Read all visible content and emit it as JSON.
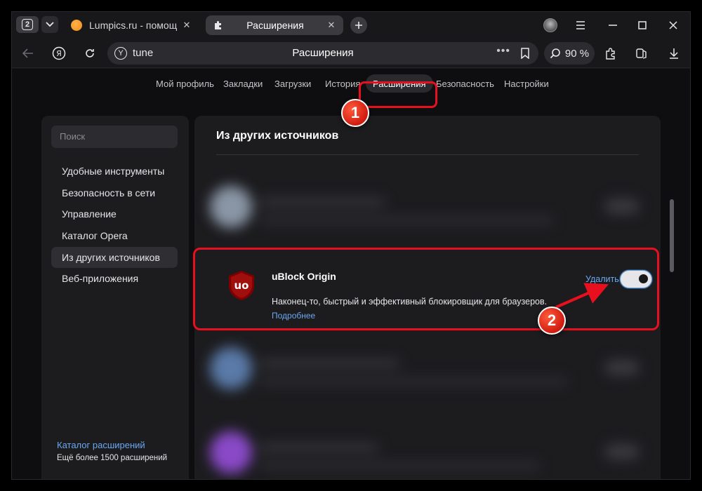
{
  "tabs": {
    "counter": "2",
    "items": [
      {
        "title": "Lumpics.ru - помощь с ком",
        "active": false
      },
      {
        "title": "Расширения",
        "active": true
      }
    ]
  },
  "omnibox": {
    "url": "tune",
    "title": "Расширения",
    "zoom": "90 %"
  },
  "top_nav": {
    "items": [
      "Мой профиль",
      "Закладки",
      "Загрузки",
      "История",
      "Расширения",
      "Безопасность",
      "Настройки"
    ],
    "active": "Расширения"
  },
  "sidebar": {
    "search_placeholder": "Поиск",
    "items": [
      "Удобные инструменты",
      "Безопасность в сети",
      "Управление",
      "Каталог Opera",
      "Из других источников",
      "Веб-приложения"
    ],
    "active": "Из других источников",
    "catalog_link": "Каталог расширений",
    "catalog_sub": "Ещё более 1500 расширений"
  },
  "content": {
    "section_title": "Из других источников",
    "extension": {
      "name": "uBlock Origin",
      "description": "Наконец-то, быстрый и эффективный блокировщик для браузеров.",
      "more_link": "Подробнее",
      "remove_label": "Удалить",
      "enabled": true,
      "icon": "ublock-shield-icon"
    }
  },
  "annotations": {
    "badge_1": "1",
    "badge_2": "2",
    "color": "#e8101f"
  }
}
